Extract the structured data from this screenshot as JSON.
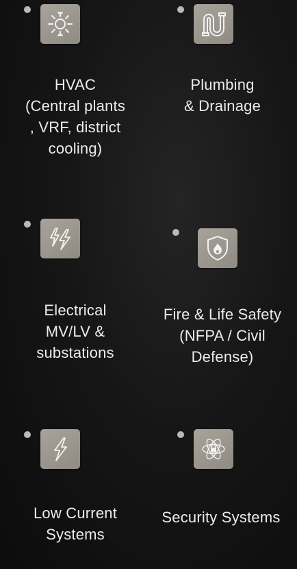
{
  "services": [
    {
      "id": "hvac",
      "icon": "snowflake-sun-icon",
      "lines": [
        "HVAC",
        "(Central plants",
        ", VRF, district",
        "cooling)"
      ]
    },
    {
      "id": "plumbing",
      "icon": "pipes-icon",
      "lines": [
        "Plumbing",
        "& Drainage"
      ]
    },
    {
      "id": "electrical",
      "icon": "double-lightning-icon",
      "lines": [
        "Electrical",
        "MV/LV &",
        "substations"
      ]
    },
    {
      "id": "fire",
      "icon": "fire-shield-icon",
      "lines": [
        "Fire & Life Safety",
        "(NFPA / Civil",
        "Defense)"
      ]
    },
    {
      "id": "low-current",
      "icon": "lightning-icon",
      "lines": [
        "Low Current",
        "Systems"
      ]
    },
    {
      "id": "security",
      "icon": "atom-lock-icon",
      "lines": [
        "Security Systems"
      ]
    }
  ],
  "colors": {
    "background": "#121212",
    "tile": "#9c978f",
    "dot": "#b9b9b9",
    "text": "#ececec"
  }
}
